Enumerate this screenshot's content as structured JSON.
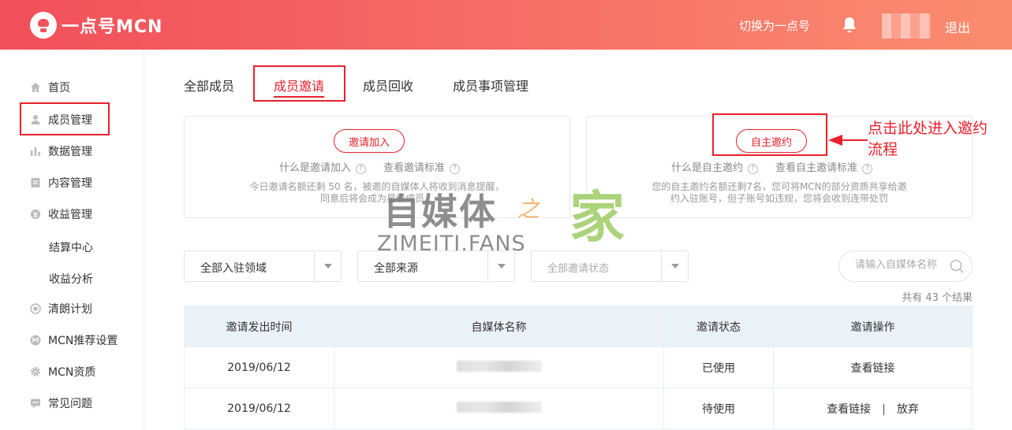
{
  "header": {
    "logo_text": "一点号MCN",
    "switch_label": "切换为一点号",
    "logout_label": "退出"
  },
  "sidebar": {
    "items": [
      {
        "label": "首页",
        "icon": "home-icon"
      },
      {
        "label": "成员管理",
        "icon": "user-icon"
      },
      {
        "label": "数据管理",
        "icon": "bar-chart-icon"
      },
      {
        "label": "内容管理",
        "icon": "document-icon"
      },
      {
        "label": "收益管理",
        "icon": "coin-icon"
      },
      {
        "label": "结算中心"
      },
      {
        "label": "收益分析"
      },
      {
        "label": "清朗计划",
        "icon": "target-icon"
      },
      {
        "label": "MCN推荐设置",
        "icon": "m-circle-icon"
      },
      {
        "label": "MCN资质",
        "icon": "gear-icon"
      },
      {
        "label": "常见问题",
        "icon": "message-icon"
      }
    ]
  },
  "tabs": [
    "全部成员",
    "成员邀请",
    "成员回收",
    "成员事项管理"
  ],
  "invite_card": {
    "button": "邀请加入",
    "link1": "什么是邀请加入",
    "link2": "查看邀请标准",
    "desc_line1": "今日邀请名额还剩 50 名，被邀的自媒体人将收到消息提醒，",
    "desc_line2": "同意后将会成为星级成员。"
  },
  "self_card": {
    "button": "自主邀约",
    "link1": "什么是自主邀约",
    "link2": "查看自主邀请标准",
    "desc_line1": "您的自主邀约名额还剩7名，您可将MCN的部分资质共享给邀",
    "desc_line2": "约入驻账号，但子账号如违规，您将会收到连带处罚"
  },
  "annotation": {
    "line1": "点击此处进入邀约",
    "line2": "流程"
  },
  "watermark": {
    "cn": "自媒体",
    "zhi": "之",
    "jia": "家",
    "en": "ZIMEITI.FANS"
  },
  "filters": {
    "domain": "全部入驻领域",
    "source": "全部来源",
    "status_placeholder": "全部邀请状态",
    "search_placeholder": "请输入自媒体名称"
  },
  "total_text": "共有 43 个结果",
  "table": {
    "columns": [
      "邀请发出时间",
      "自媒体名称",
      "邀请状态",
      "邀请操作"
    ],
    "rows": [
      {
        "date": "2019/06/12",
        "status": "已使用",
        "actions": [
          "查看链接"
        ]
      },
      {
        "date": "2019/06/12",
        "status": "待使用",
        "actions": [
          "查看链接",
          "放弃"
        ],
        "separator": "|"
      }
    ]
  },
  "colors": {
    "accent": "#e8202b",
    "header_start": "#f14f5a",
    "header_end": "#fb8d6f"
  }
}
